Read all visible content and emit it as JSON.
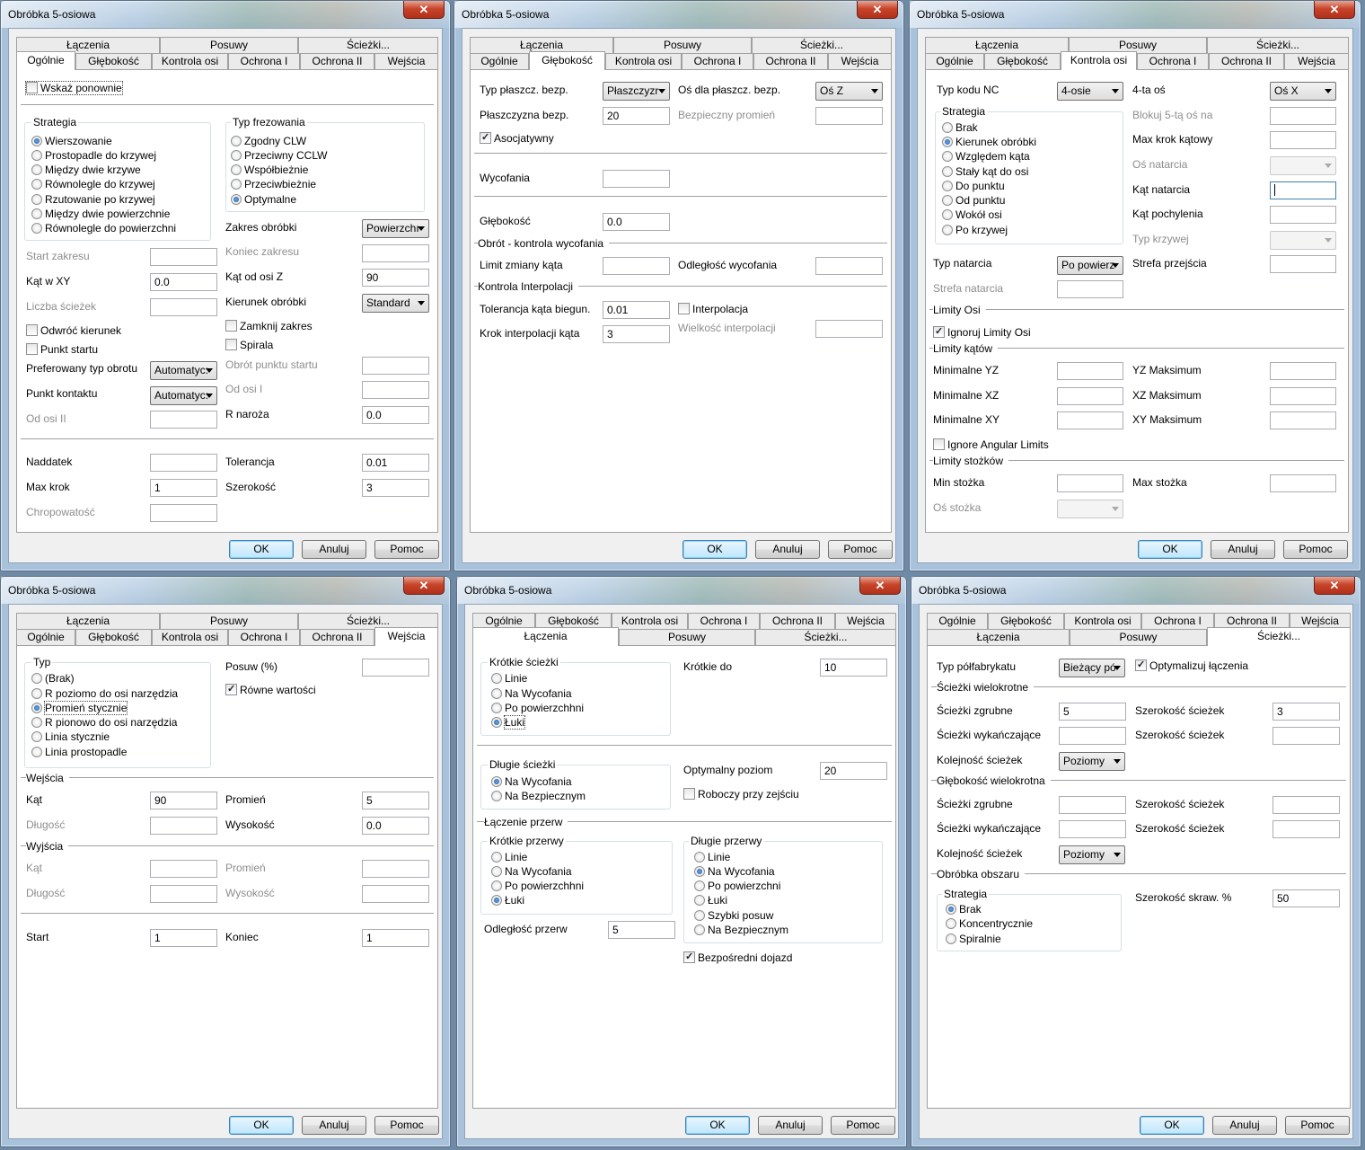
{
  "window_title": "Obróbka 5-osiowa",
  "close_glyph": "✕",
  "tabs": {
    "laczenia": "Łączenia",
    "posuwy": "Posuwy",
    "sciezki": "Ścieżki...",
    "ogolne": "Ogólnie",
    "glebokosc": "Głębokość",
    "kontrola": "Kontrola osi",
    "ochrona1": "Ochrona I",
    "ochrona2": "Ochrona II",
    "wejscia": "Wejścia"
  },
  "buttons": {
    "ok": "OK",
    "anuluj": "Anuluj",
    "pomoc": "Pomoc"
  },
  "w1": {
    "wskaz": "Wskaż ponownie",
    "strategia_title": "Strategia",
    "strategia": [
      "Wierszowanie",
      "Prostopadle do krzywej",
      "Między dwie krzywe",
      "Równolegle do krzywej",
      "Rzutowanie po krzywej",
      "Między dwie powierzchnie",
      "Równolegle do powierzchni"
    ],
    "typ_title": "Typ frezowania",
    "typ": [
      "Zgodny CLW",
      "Przeciwny CCLW",
      "Współbieżnie",
      "Przeciwbieżnie",
      "Optymalne"
    ],
    "start_zakresu": "Start zakresu",
    "koniec_zakresu": "Koniec zakresu",
    "zakres_obrobki": "Zakres obróbki",
    "zakres_val": "Powierzchı",
    "kat_xy": "Kąt w XY",
    "kat_xy_val": "0.0",
    "kat_z": "Kąt od osi Z",
    "kat_z_val": "90",
    "liczba": "Liczba ścieżek",
    "kierunek": "Kierunek obróbki",
    "kierunek_val": "Standard",
    "odwroc": "Odwróć kierunek",
    "zamknij": "Zamknij zakres",
    "punkt_startu": "Punkt startu",
    "spirala": "Spirala",
    "pref": "Preferowany typ obrotu",
    "pref_val": "Automatyc:",
    "obrot": "Obrót punktu startu",
    "kontakt": "Punkt kontaktu",
    "kontakt_val": "Automatyc:",
    "od_osi_1": "Od osi I",
    "od_osi_2": "Od osi II",
    "r_naroza": "R naroża",
    "r_val": "0.0",
    "naddatek": "Naddatek",
    "tolerancja": "Tolerancja",
    "tol_val": "0.01",
    "max_krok": "Max krok",
    "max_val": "1",
    "szerokosc": "Szerokość",
    "szer_val": "3",
    "chropowatosc": "Chropowatość"
  },
  "w2": {
    "typ_pl": "Typ płaszcz. bezp.",
    "typ_pl_val": "Płaszczyzr",
    "os_pl": "Oś dla płaszcz. bezp.",
    "os_pl_val": "Oś Z",
    "pl_bezp": "Płaszczyzna bezp.",
    "pl_bezp_val": "20",
    "bezp_prom": "Bezpieczny promień",
    "asoc": "Asocjatywny",
    "wycofania": "Wycofania",
    "glebokosc": "Głębokość",
    "gleb_val": "0.0",
    "obrot_sec": "Obrót - kontrola wycofania",
    "limit": "Limit zmiany kąta",
    "odleglosc": "Odległość wycofania",
    "interp_sec": "Kontrola Interpolacji",
    "tol_kata": "Tolerancja kąta biegun.",
    "tol_kata_val": "0.01",
    "interpolacja": "Interpolacja",
    "krok_interp": "Krok interpolacji kąta",
    "krok_val": "3",
    "wielkosc": "Wielkość interpolacji"
  },
  "w3": {
    "typ_nc": "Typ kodu NC",
    "typ_nc_val": "4-osie",
    "os4": "4-ta oś",
    "os4_val": "Oś X",
    "strategia_title": "Strategia",
    "strategia": [
      "Brak",
      "Kierunek obróbki",
      "Względem kąta",
      "Stały kąt do osi",
      "Do punktu",
      "Od punktu",
      "Wokół osi",
      "Po krzywej"
    ],
    "blokuj": "Blokuj 5-tą oś na",
    "max_krok_kat": "Max krok kątowy",
    "os_natarcia": "Oś natarcia",
    "kat_natarcia": "Kąt natarcia",
    "kat_pochylenia": "Kąt pochylenia",
    "typ_krzywej": "Typ krzywej",
    "typ_natarcia": "Typ natarcia",
    "typ_natarcia_val": "Po powierz",
    "strefa_przejscia": "Strefa przejścia",
    "strefa_natarcia": "Strefa natarcia",
    "limity_osi": "Limity Osi",
    "ignoruj": "Ignoruj Limity Osi",
    "limity_katow": "Limity kątów",
    "min_yz": "Minimalne YZ",
    "max_yz": "YZ Maksimum",
    "min_xz": "Minimalne XZ",
    "max_xz": "XZ Maksimum",
    "min_xy": "Minimalne XY",
    "max_xy": "XY Maksimum",
    "ignore_ang": "Ignore Angular Limits",
    "limity_stozkow": "Limity stożków",
    "min_stozka": "Min stożka",
    "max_stozka": "Max stożka",
    "os_stozka": "Oś stożka"
  },
  "w4": {
    "typ_title": "Typ",
    "typ": [
      "(Brak)",
      "R poziomo do osi narzędzia",
      "Promień stycznie",
      "R pionowo do osi narzędzia",
      "Linia stycznie",
      "Linia prostopadle"
    ],
    "posuw": "Posuw (%)",
    "rowne": "Równe wartości",
    "wejscia_sec": "Wejścia",
    "kat": "Kąt",
    "kat_val": "90",
    "promien": "Promień",
    "prom_val": "5",
    "dlugosc": "Długość",
    "wysokosc": "Wysokość",
    "wys_val": "0.0",
    "wyjscia_sec": "Wyjścia",
    "kat2": "Kąt",
    "promien2": "Promień",
    "dlugosc2": "Długość",
    "wysokosc2": "Wysokość",
    "start": "Start",
    "start_val": "1",
    "koniec": "Koniec",
    "koniec_val": "1"
  },
  "w5": {
    "krotkie_title": "Krótkie ścieżki",
    "krotkie": [
      "Linie",
      "Na Wycofania",
      "Po powierzchhni",
      "Łuki"
    ],
    "krotkie_do": "Krótkie do",
    "krotkie_do_val": "10",
    "dlugie_title": "Długie ścieżki",
    "dlugie": [
      "Na Wycofania",
      "Na Bezpiecznym"
    ],
    "optymalny": "Optymalny poziom",
    "opt_val": "20",
    "roboczy": "Roboczy przy zejściu",
    "laczenie_sec": "Łączenie przerw",
    "kr_przerwy_title": "Krótkie przerwy",
    "kr_przerwy": [
      "Linie",
      "Na Wycofania",
      "Po powierzchhni",
      "Łuki"
    ],
    "dl_przerwy_title": "Długie przerwy",
    "dl_przerwy": [
      "Linie",
      "Na Wycofania",
      "Po powierzchni",
      "Łuki",
      "Szybki posuw",
      "Na Bezpiecznym"
    ],
    "odleglosc": "Odległość przerw",
    "odl_val": "5",
    "bezposredni": "Bezpośredni dojazd"
  },
  "w6": {
    "typ_pol": "Typ półfabrykatu",
    "typ_pol_val": "Bieżący pó",
    "optymalizuj": "Optymalizuj łączenia",
    "wielokrotne_sec": "Ścieżki wielokrotne",
    "zgrubne": "Ścieżki zgrubne",
    "zgrubne_val": "5",
    "szer": "Szerokość ścieżek",
    "szer_val": "3",
    "wykanczajace": "Ścieżki wykańczające",
    "kolejnosc": "Kolejność ścieżek",
    "kolejnosc_val": "Poziomy",
    "glebokosc_sec": "Głębokość wielokrotna",
    "obszar_sec": "Obróbka obszaru",
    "strategia_title": "Strategia",
    "strategia": [
      "Brak",
      "Koncentrycznie",
      "Spiralnie"
    ],
    "szer_skraw": "Szerokość skraw. %",
    "szer_skraw_val": "50"
  }
}
